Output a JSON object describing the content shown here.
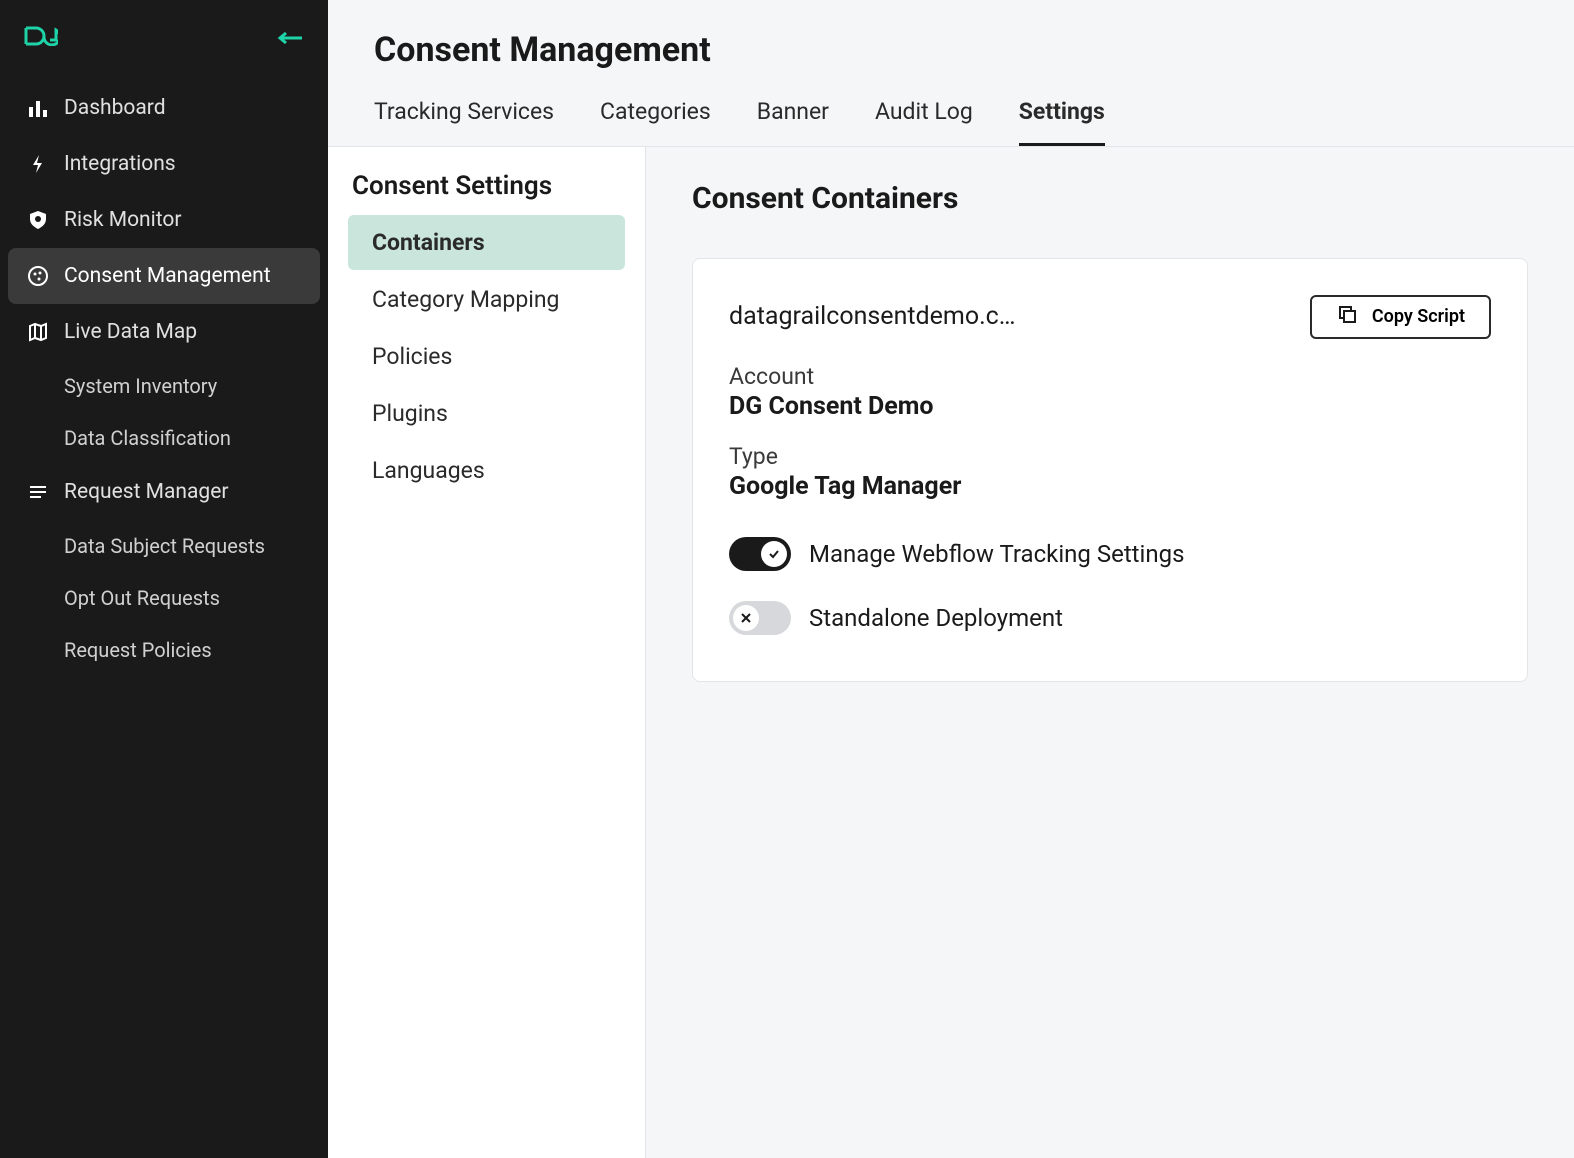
{
  "sidebar": {
    "items": [
      {
        "icon": "chart",
        "label": "Dashboard"
      },
      {
        "icon": "bolt",
        "label": "Integrations"
      },
      {
        "icon": "shield",
        "label": "Risk Monitor"
      },
      {
        "icon": "cookie",
        "label": "Consent Management",
        "active": true
      },
      {
        "icon": "map",
        "label": "Live Data Map",
        "children": [
          {
            "label": "System Inventory"
          },
          {
            "label": "Data Classification"
          }
        ]
      },
      {
        "icon": "list",
        "label": "Request Manager",
        "children": [
          {
            "label": "Data Subject Requests"
          },
          {
            "label": "Opt Out Requests"
          },
          {
            "label": "Request Policies"
          }
        ]
      }
    ]
  },
  "header": {
    "title": "Consent Management",
    "tabs": [
      {
        "label": "Tracking Services"
      },
      {
        "label": "Categories"
      },
      {
        "label": "Banner"
      },
      {
        "label": "Audit Log"
      },
      {
        "label": "Settings",
        "active": true
      }
    ]
  },
  "settings_panel": {
    "title": "Consent Settings",
    "items": [
      {
        "label": "Containers",
        "active": true
      },
      {
        "label": "Category Mapping"
      },
      {
        "label": "Policies"
      },
      {
        "label": "Plugins"
      },
      {
        "label": "Languages"
      }
    ]
  },
  "detail": {
    "title": "Consent Containers",
    "container": {
      "url": "datagrailconsentdemo.c…",
      "copy_label": "Copy Script",
      "account_label": "Account",
      "account_value": "DG Consent Demo",
      "type_label": "Type",
      "type_value": "Google Tag Manager",
      "toggles": [
        {
          "label": "Manage Webflow Tracking Settings",
          "on": true
        },
        {
          "label": "Standalone Deployment",
          "on": false
        }
      ]
    }
  }
}
